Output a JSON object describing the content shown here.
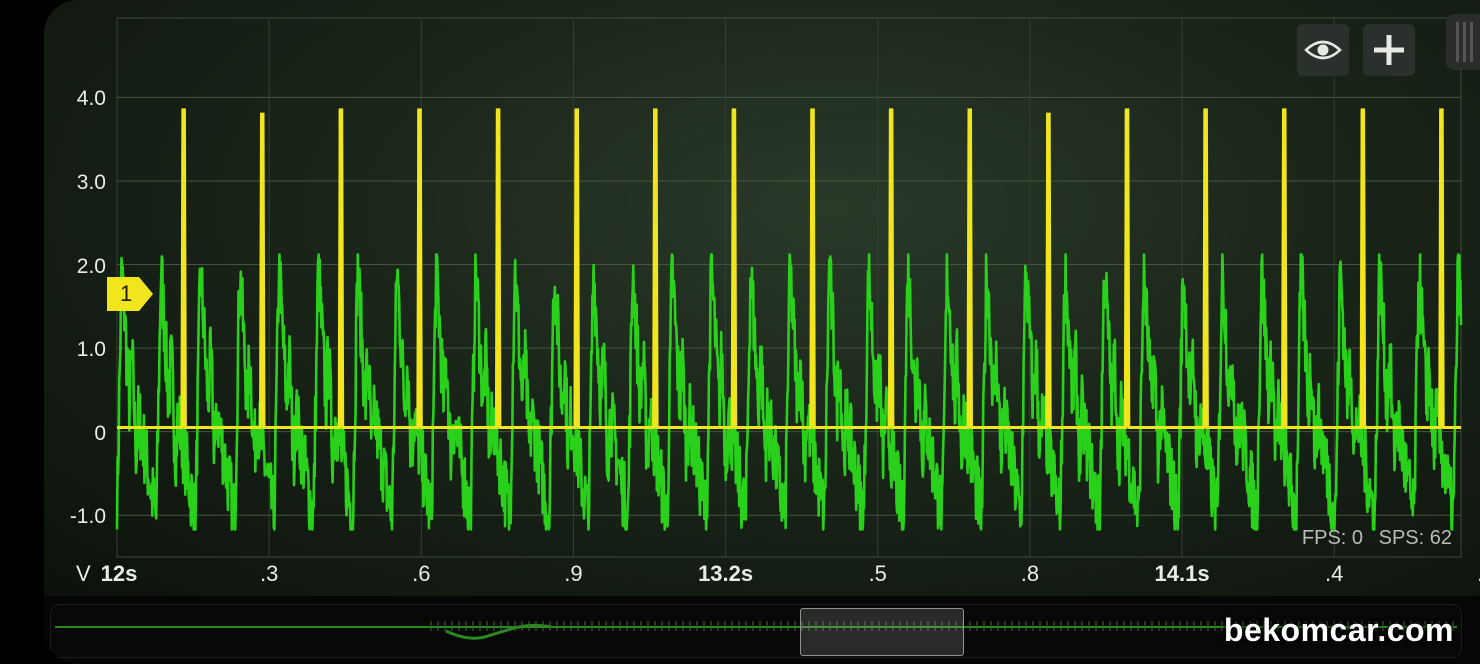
{
  "chart_data": {
    "type": "line",
    "y_ticks": [
      "4.0",
      "3.0",
      "2.0",
      "1.0",
      "0",
      "-1.0"
    ],
    "y_tick_values": [
      4,
      3,
      2,
      1,
      0,
      -1
    ],
    "ylim": [
      -1.5,
      4.95
    ],
    "y_unit": "V",
    "x_ticks": [
      {
        "label": "12s",
        "t": 12.0,
        "major": true
      },
      {
        "label": ".3",
        "t": 12.3,
        "major": false
      },
      {
        "label": ".6",
        "t": 12.6,
        "major": false
      },
      {
        "label": ".9",
        "t": 12.9,
        "major": false
      },
      {
        "label": "13.2s",
        "t": 13.2,
        "major": true
      },
      {
        "label": ".5",
        "t": 13.5,
        "major": false
      },
      {
        "label": ".8",
        "t": 13.8,
        "major": false
      },
      {
        "label": "14.1s",
        "t": 14.1,
        "major": true
      },
      {
        "label": ".4",
        "t": 14.4,
        "major": false
      },
      {
        "label": ".7",
        "t": 14.7,
        "major": false
      }
    ],
    "xlim": [
      12.0,
      14.65
    ],
    "grid": true,
    "series": [
      {
        "color": "#f1e51e",
        "baseline": 0.05,
        "spike_times": [
          12.13,
          12.285,
          12.44,
          12.595,
          12.75,
          12.905,
          13.06,
          13.215,
          13.37,
          13.525,
          13.68,
          13.835,
          13.99,
          14.145,
          14.3,
          14.455,
          14.61
        ],
        "spike_peaks": [
          3.85,
          3.8,
          3.85,
          3.85,
          3.85,
          3.85,
          3.85,
          3.85,
          3.85,
          3.85,
          3.85,
          3.8,
          3.85,
          3.85,
          3.85,
          3.85,
          3.85
        ]
      },
      {
        "color": "#2ad11a",
        "period": 0.0775,
        "peak": 2.0,
        "trough": -1.05,
        "mean": 0.1
      }
    ],
    "trigger_marker": {
      "label": "1",
      "value": 1.65,
      "color": "#f1e51e"
    }
  },
  "toolbar": {
    "eye_icon": "eye-icon",
    "add_icon": "plus-icon"
  },
  "stats": {
    "fps": "FPS: 0",
    "sps": "SPS: 62"
  },
  "watermark": "bekomcar.com"
}
